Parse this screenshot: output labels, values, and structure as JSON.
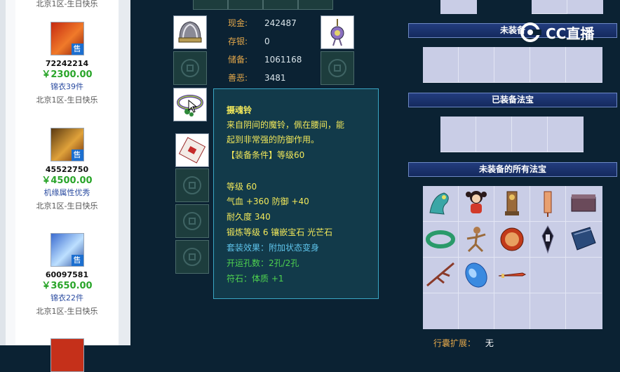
{
  "listings": [
    {
      "server": "北京1区-生日快乐"
    },
    {
      "id": "72242214",
      "price": "￥2300.00",
      "desc": "锦衣39件",
      "server": "北京1区-生日快乐",
      "sell": "售"
    },
    {
      "id": "45522750",
      "price": "￥4500.00",
      "desc": "机缘属性优秀",
      "server": "北京1区-生日快乐",
      "sell": "售"
    },
    {
      "id": "60097581",
      "price": "￥3650.00",
      "desc": "锦衣22件",
      "server": "北京1区-生日快乐",
      "sell": "售"
    }
  ],
  "stats": [
    {
      "label": "现金:",
      "value": "242487"
    },
    {
      "label": "存银:",
      "value": "0"
    },
    {
      "label": "储备:",
      "value": "1061168"
    },
    {
      "label": "善恶:",
      "value": "3481"
    }
  ],
  "tooltip": {
    "name": "摄魂铃",
    "desc1": "来自阴间的魔铃，佩在腰间，能",
    "desc2": "起到非常强的防御作用。",
    "requirement": "【装备条件】等级60",
    "level": "等级 60",
    "hp_def": "气血 +360 防御 +40",
    "durability": "耐久度 340",
    "forge": "锻炼等级 6 镶嵌宝石 光芒石",
    "set_effect": "套装效果：附加状态变身",
    "holes": "开运孔数：2孔/2孔",
    "rune": "符石：体质 +1"
  },
  "sections": {
    "unequipped": "未装备",
    "equipped_treasures": "已装备法宝",
    "all_unequipped_treasures": "未装备的所有法宝",
    "bottom_label": "行囊扩展：",
    "bottom_value": "无"
  },
  "watermark": "CC直播",
  "colors": {
    "gold": "#e3a74a",
    "tooltip_text": "#f2e85a",
    "tooltip_blue": "#5ec3ea",
    "tooltip_green": "#4fd24f",
    "price_green": "#2aa52a"
  }
}
